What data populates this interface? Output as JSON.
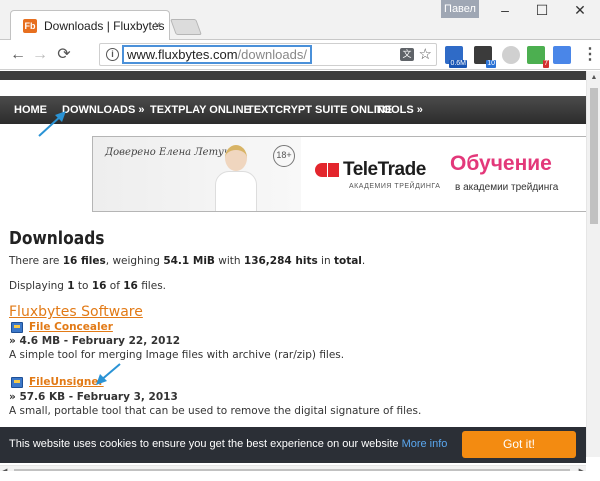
{
  "browser": {
    "tab_title": "Downloads | Fluxbytes",
    "tab_favicon": "Fb",
    "user_name": "Павел",
    "url_host": "www.fluxbytes.com",
    "url_path": "/downloads/",
    "ext_badges": {
      "one": "0.6M",
      "two": "10",
      "three": "7"
    },
    "icons": {
      "back": "←",
      "forward": "→",
      "reload": "⟳",
      "info": "i",
      "translate": "文",
      "star": "☆",
      "menu": "⋮",
      "close": "×",
      "minimize": "–",
      "maximize": "☐",
      "window_close": "✕"
    }
  },
  "site": {
    "nav": [
      {
        "label": "HOME"
      },
      {
        "label": "DOWNLOADS »"
      },
      {
        "label": "TEXTPLAY ONLINE"
      },
      {
        "label": "TEXTCRYPT SUITE ONLINE"
      },
      {
        "label": "TOOLS »"
      }
    ],
    "ad": {
      "signature": "Доверено Елена Летучая",
      "age": "18+",
      "brand": "TeleTrade",
      "brand_sub": "АКАДЕМИЯ ТРЕЙДИНГА",
      "title": "Обучение",
      "subtitle": "в академии трейдинга"
    },
    "heading": "Downloads",
    "summary": {
      "prefix": "There are ",
      "files": "16 files",
      "weighing": ", weighing ",
      "size": "54.1 MiB",
      "with": " with ",
      "hits": "136,284 hits",
      "in": " in ",
      "total": "total",
      "end": "."
    },
    "displaying": {
      "prefix": "Displaying ",
      "from": "1",
      "to_word": " to ",
      "to": "16",
      "of_word": " of ",
      "count": "16",
      "suffix": " files."
    },
    "section_title": "Fluxbytes Software",
    "files": [
      {
        "name": "File Concealer",
        "meta": "» 4.6 MB - February 22, 2012",
        "desc": "A simple tool for merging Image files with archive (rar/zip) files."
      },
      {
        "name": "FileUnsigner",
        "meta": "» 57.6 KB - February 3, 2013",
        "desc": "A small, portable tool that can be used to remove the digital signature of files."
      }
    ],
    "cookie": {
      "text": "This website uses cookies to ensure you get the best experience on our website ",
      "link": "More info",
      "button": "Got it!"
    }
  },
  "colors": {
    "accent_orange": "#e27a16",
    "cookie_button": "#f38b11",
    "annotation_arrow": "#2a93d5"
  }
}
